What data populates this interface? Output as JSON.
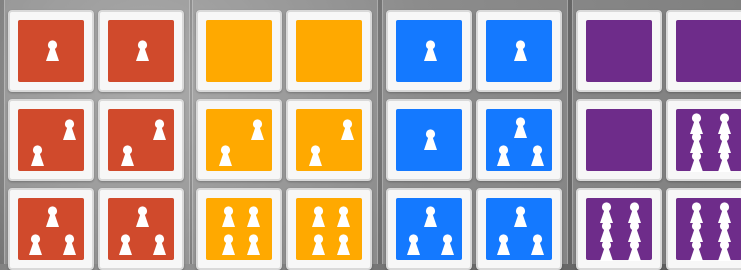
{
  "colors": {
    "red": "#d04a2c",
    "orange": "#ffa900",
    "blue": "#1479ff",
    "purple": "#6e2c8a",
    "pawn": "#ffffff"
  },
  "board": {
    "groups": [
      {
        "name": "red",
        "rows": [
          [
            {
              "color": "red",
              "pawns": 1
            },
            {
              "color": "red",
              "pawns": 1
            }
          ],
          [
            {
              "color": "red",
              "pawns": 2
            },
            {
              "color": "red",
              "pawns": 2
            }
          ],
          [
            {
              "color": "red",
              "pawns": 3
            },
            {
              "color": "red",
              "pawns": 3
            }
          ]
        ]
      },
      {
        "name": "orange",
        "rows": [
          [
            {
              "color": "orange",
              "pawns": 0
            },
            {
              "color": "orange",
              "pawns": 0
            }
          ],
          [
            {
              "color": "orange",
              "pawns": 2
            },
            {
              "color": "orange",
              "pawns": 2
            }
          ],
          [
            {
              "color": "orange",
              "pawns": 4
            },
            {
              "color": "orange",
              "pawns": 4
            }
          ]
        ]
      },
      {
        "name": "blue",
        "rows": [
          [
            {
              "color": "blue",
              "pawns": 1
            },
            {
              "color": "blue",
              "pawns": 1
            }
          ],
          [
            {
              "color": "blue",
              "pawns": 1
            },
            {
              "color": "blue",
              "pawns": 3
            }
          ],
          [
            {
              "color": "blue",
              "pawns": 3
            },
            {
              "color": "blue",
              "pawns": 3
            }
          ]
        ]
      },
      {
        "name": "purple",
        "rows": [
          [
            {
              "color": "purple",
              "pawns": 0
            },
            {
              "color": "purple",
              "pawns": 0
            }
          ],
          [
            {
              "color": "purple",
              "pawns": 0
            },
            {
              "color": "purple",
              "pawns": 6
            }
          ],
          [
            {
              "color": "purple",
              "pawns": 6
            },
            {
              "color": "purple",
              "pawns": 6
            }
          ]
        ]
      }
    ]
  }
}
